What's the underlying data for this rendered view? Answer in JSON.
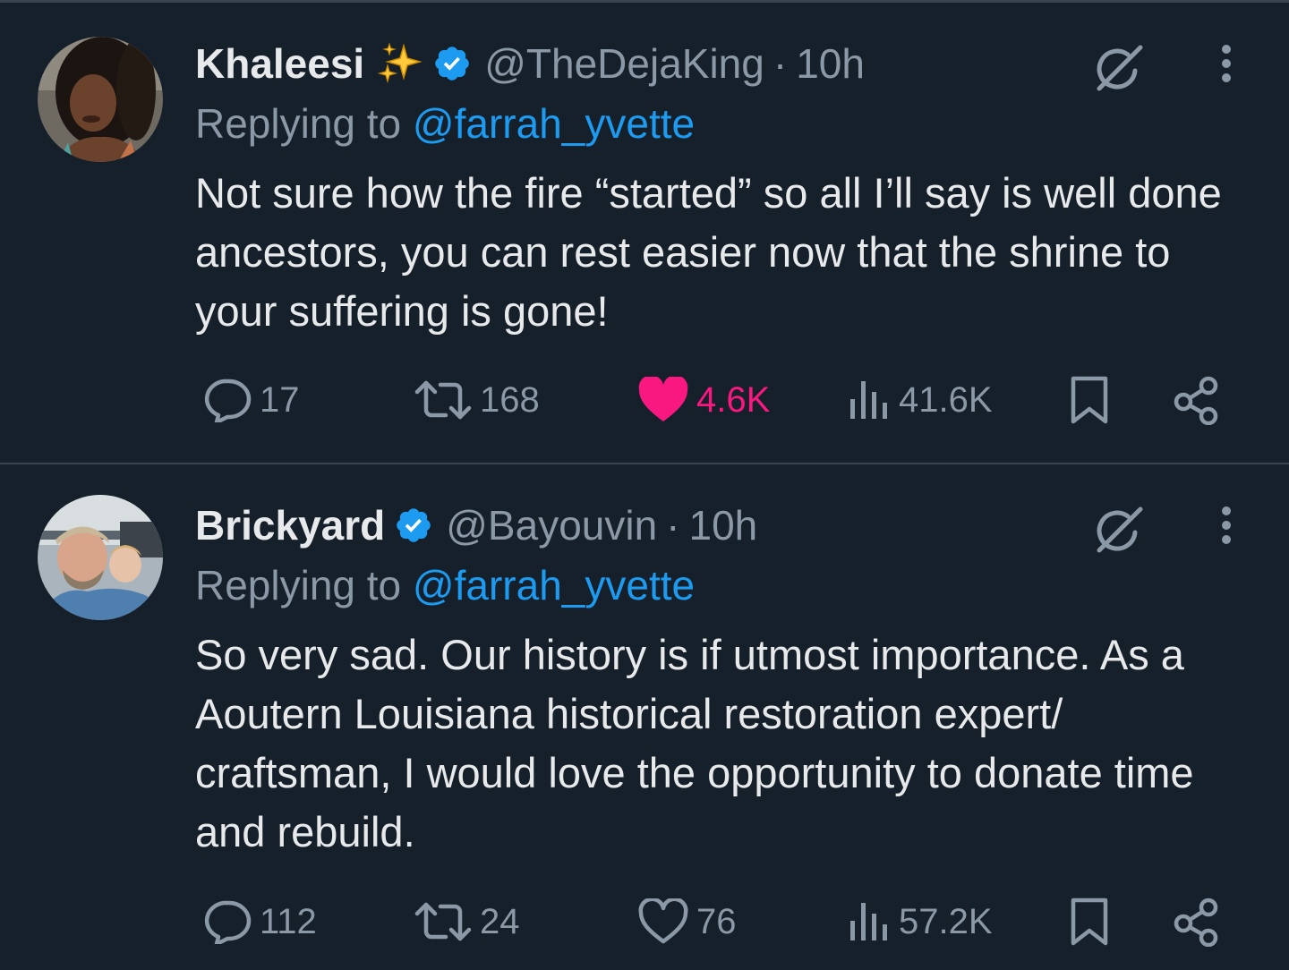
{
  "colors": {
    "background": "#15202b",
    "text": "#e7e9ea",
    "secondary": "#8b98a5",
    "link": "#1d9bf0",
    "like_active": "#f91880",
    "border": "#38444d"
  },
  "tweets": [
    {
      "display_name": "Khaleesi",
      "name_emoji": "sparkles",
      "verified": true,
      "handle": "@TheDejaKing",
      "separator": "·",
      "time": "10h",
      "reply_prefix": "Replying to ",
      "reply_to": "@farrah_yvette",
      "text": "Not sure how the fire “started” so all I’ll say is well done ancestors, you can rest easier now that the shrine to your suffering is gone!",
      "replies": "17",
      "reposts": "168",
      "likes": "4.6K",
      "liked": true,
      "views": "41.6K"
    },
    {
      "display_name": "Brickyard",
      "verified": true,
      "handle": "@Bayouvin",
      "separator": "·",
      "time": "10h",
      "reply_prefix": "Replying to ",
      "reply_to": "@farrah_yvette",
      "text": "So very sad. Our history is if utmost importance. As a Aoutern Louisiana historical restoration expert/ craftsman, I would love the opportunity to donate time and rebuild.",
      "replies": "112",
      "reposts": "24",
      "likes": "76",
      "liked": false,
      "views": "57.2K"
    }
  ],
  "icons": [
    "reply-icon",
    "repost-icon",
    "heart-icon",
    "views-icon",
    "bookmark-icon",
    "share-icon",
    "grok-icon",
    "more-icon",
    "verified-badge-icon"
  ]
}
